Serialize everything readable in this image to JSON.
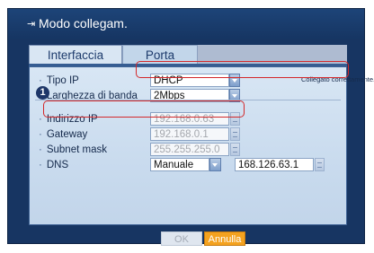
{
  "window": {
    "title": "Modo collegam."
  },
  "tabs": [
    {
      "label": "Interfaccia",
      "active": true
    },
    {
      "label": "Porta",
      "active": false
    }
  ],
  "marker": {
    "number": "1"
  },
  "rows": {
    "ip_type": {
      "label": "Tipo IP",
      "value": "DHCP",
      "status": "Collegato correttamente."
    },
    "bandwidth": {
      "label": "Larghezza di banda",
      "value": "2Mbps"
    },
    "ip_address": {
      "label": "Indirizzo IP",
      "value": "192.168.0.63"
    },
    "gateway": {
      "label": "Gateway",
      "value": "192.168.0.1"
    },
    "subnet": {
      "label": "Subnet mask",
      "value": "255.255.255.0"
    },
    "dns": {
      "label": "DNS",
      "mode": "Manuale",
      "value": "168.126.63.1"
    }
  },
  "buttons": {
    "ok": "OK",
    "cancel": "Annulla"
  },
  "colors": {
    "highlight_box": "#d3292b",
    "cancel_button": "#f4a21f",
    "window_background": "#173562"
  }
}
